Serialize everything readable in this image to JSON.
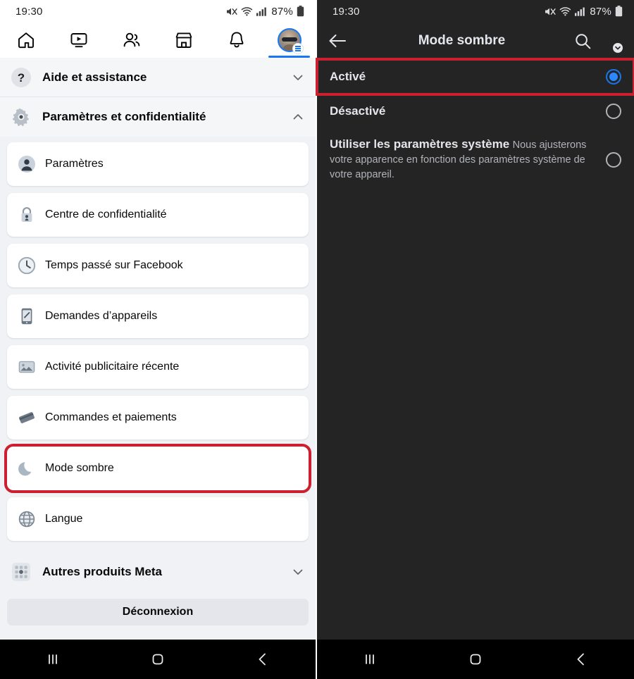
{
  "colors": {
    "accent_blue": "#1877f2",
    "radio_blue": "#1b74e4",
    "highlight_red": "#cc2030",
    "light_bg": "#f0f2f5",
    "dark_bg": "#242424",
    "dark_text": "#e4e6eb",
    "dark_subtext": "#b0b3b8"
  },
  "status_bar": {
    "time": "19:30",
    "battery_percent": "87%",
    "icons": [
      "mute-icon",
      "wifi-icon",
      "signal-icon",
      "battery-icon"
    ]
  },
  "left_screen": {
    "tabbar": {
      "tabs": [
        {
          "name": "home-icon",
          "label": "Accueil",
          "active": false
        },
        {
          "name": "video-icon",
          "label": "Vidéo",
          "active": false
        },
        {
          "name": "friends-icon",
          "label": "Amis",
          "active": false
        },
        {
          "name": "marketplace-icon",
          "label": "Marketplace",
          "active": false
        },
        {
          "name": "notifications-bell-icon",
          "label": "Notifications",
          "active": false
        },
        {
          "name": "profile-menu-avatar",
          "label": "Menu",
          "active": true
        }
      ]
    },
    "sections": [
      {
        "icon": "help-circle-icon",
        "label": "Aide et assistance",
        "expanded": false,
        "chevron": "chevron-down-icon"
      },
      {
        "icon": "gear-icon",
        "label": "Paramètres et confidentialité",
        "expanded": true,
        "chevron": "chevron-up-icon"
      }
    ],
    "items": [
      {
        "icon": "account-circle-icon",
        "label": "Paramètres",
        "highlighted": false
      },
      {
        "icon": "lock-icon",
        "label": "Centre de confidentialité",
        "highlighted": false
      },
      {
        "icon": "clock-icon",
        "label": "Temps passé sur Facebook",
        "highlighted": false
      },
      {
        "icon": "device-request-icon",
        "label": "Demandes d’appareils",
        "highlighted": false
      },
      {
        "icon": "ad-activity-icon",
        "label": "Activité publicitaire récente",
        "highlighted": false
      },
      {
        "icon": "credit-card-icon",
        "label": "Commandes et paiements",
        "highlighted": false
      },
      {
        "icon": "moon-icon",
        "label": "Mode sombre",
        "highlighted": true
      },
      {
        "icon": "globe-icon",
        "label": "Langue",
        "highlighted": false
      }
    ],
    "meta_section": {
      "icon": "apps-grid-icon",
      "label": "Autres produits Meta",
      "chevron": "chevron-down-icon"
    },
    "logout_label": "Déconnexion"
  },
  "right_screen": {
    "header": {
      "back": "back-arrow-icon",
      "title": "Mode sombre",
      "search": "search-icon",
      "avatar": "profile-avatar"
    },
    "options": [
      {
        "title": "Activé",
        "subtitle": "",
        "selected": true,
        "highlighted": true
      },
      {
        "title": "Désactivé",
        "subtitle": "",
        "selected": false,
        "highlighted": false
      },
      {
        "title": "Utiliser les paramètres système",
        "subtitle": "Nous ajusterons votre apparence en fonction des paramètres système de votre appareil.",
        "selected": false,
        "highlighted": false
      }
    ]
  },
  "nav_bar": {
    "recents": "recents-icon",
    "home": "home-square-icon",
    "back": "back-chevron-icon"
  }
}
